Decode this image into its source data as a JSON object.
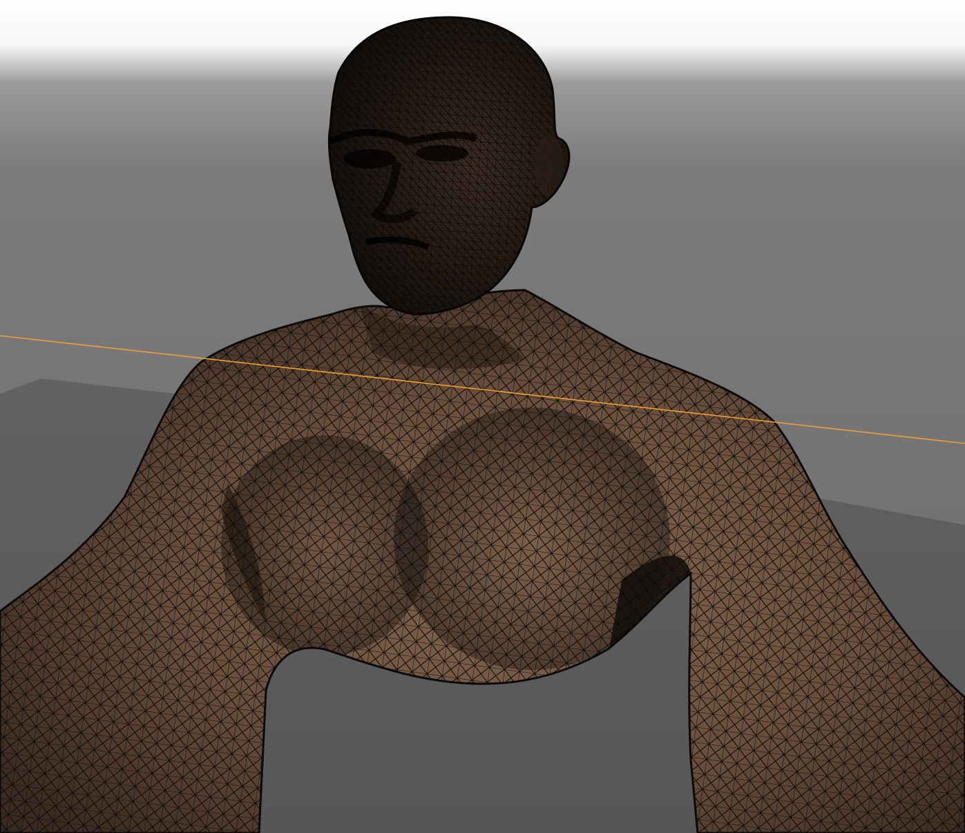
{
  "viewport": {
    "mode": "wireframe-on-shaded",
    "colors": {
      "sky_top": "#ffffff",
      "horizon": "#8a8a8a",
      "background": "#6e6e6e",
      "floor": "#5d5d5d",
      "skin_light": "#7a5e48",
      "skin_mid": "#5e4535",
      "skin_dark": "#2a1e17",
      "wire": "#0b0b0b",
      "axis_line": "#f0a030"
    }
  },
  "model": {
    "name": "male-bust-mesh"
  }
}
